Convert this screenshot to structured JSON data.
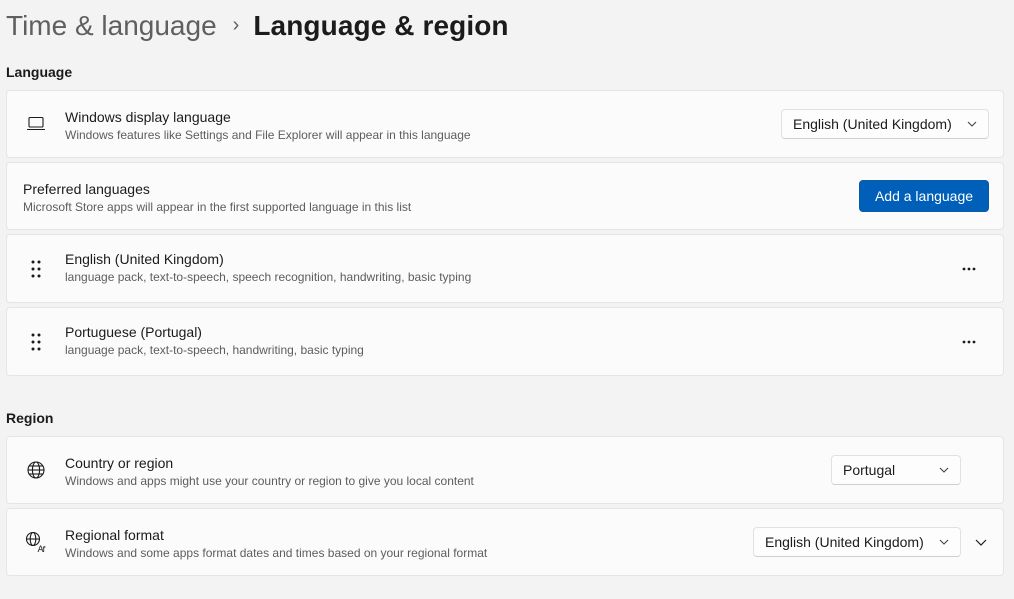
{
  "breadcrumb": {
    "parent": "Time & language",
    "separator": "›",
    "current": "Language & region"
  },
  "language_section": {
    "title": "Language",
    "display_language": {
      "icon": "laptop-icon",
      "title": "Windows display language",
      "description": "Windows features like Settings and File Explorer will appear in this language",
      "selected": "English (United Kingdom)"
    },
    "preferred": {
      "title": "Preferred languages",
      "description": "Microsoft Store apps will appear in the first supported language in this list",
      "add_button": "Add a language"
    },
    "languages": [
      {
        "name": "English (United Kingdom)",
        "features": "language pack, text-to-speech, speech recognition, handwriting, basic typing"
      },
      {
        "name": "Portuguese (Portugal)",
        "features": "language pack, text-to-speech, handwriting, basic typing"
      }
    ]
  },
  "region_section": {
    "title": "Region",
    "country": {
      "icon": "globe-icon",
      "title": "Country or region",
      "description": "Windows and apps might use your country or region to give you local content",
      "selected": "Portugal"
    },
    "format": {
      "icon": "regional-format-icon",
      "title": "Regional format",
      "description": "Windows and some apps format dates and times based on your regional format",
      "selected": "English (United Kingdom)"
    }
  },
  "colors": {
    "accent": "#005fb8",
    "background": "#f3f3f3",
    "card": "#fbfbfb"
  }
}
